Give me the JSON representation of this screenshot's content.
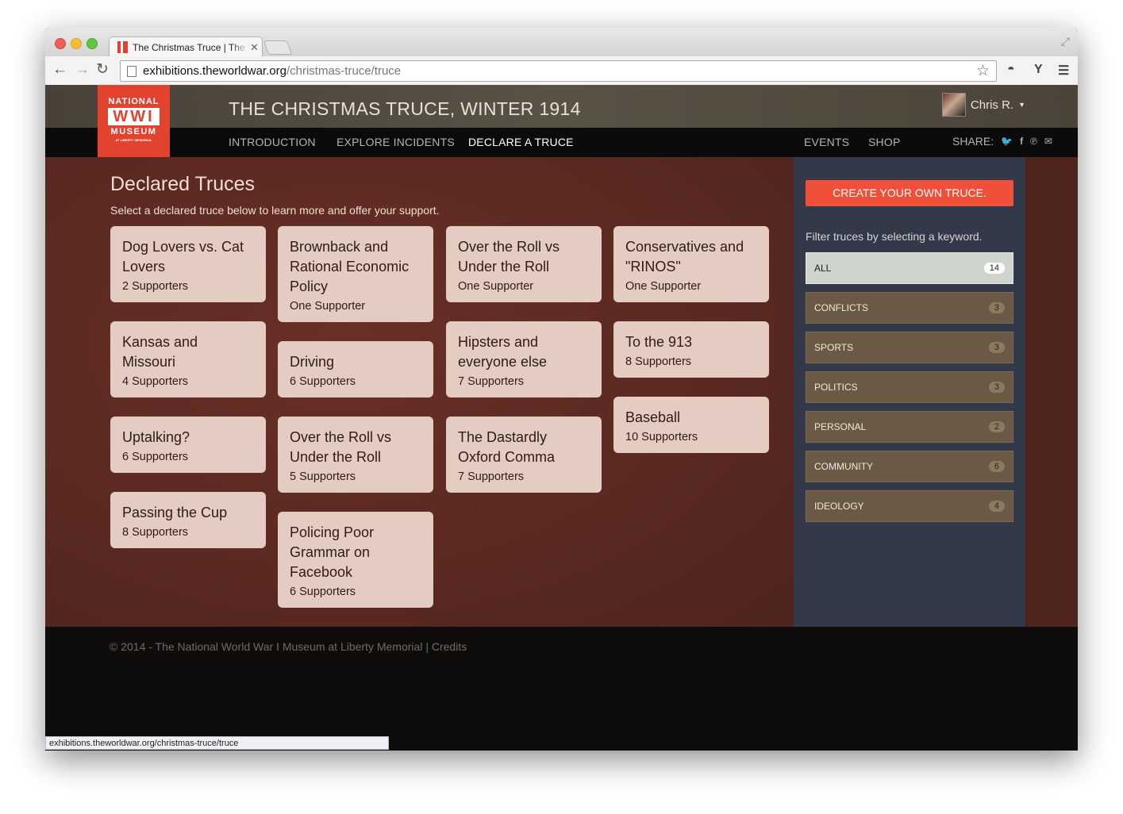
{
  "browser": {
    "tab_title": "The Christmas Truce | The",
    "url_host": "exhibitions.theworldwar.org",
    "url_path": "/christmas-truce/truce",
    "status_url": "exhibitions.theworldwar.org/christmas-truce/truce"
  },
  "site": {
    "logo": {
      "line1": "NATIONAL",
      "line2": "WWI",
      "line3": "MUSEUM",
      "line4": "AT LIBERTY MEMORIAL"
    },
    "title": "THE CHRISTMAS TRUCE, WINTER 1914",
    "user_name": "Chris R.",
    "nav": {
      "introduction": "INTRODUCTION",
      "explore": "EXPLORE INCIDENTS",
      "declare": "DECLARE A TRUCE",
      "events": "EVENTS",
      "shop": "SHOP",
      "share": "SHARE:"
    },
    "share_icons": [
      "twitter-icon",
      "facebook-icon",
      "pinterest-icon",
      "email-icon"
    ]
  },
  "main": {
    "title": "Declared Truces",
    "subtitle": "Select a declared truce below to learn more and offer your support.",
    "cards": [
      {
        "title": "Dog Lovers vs. Cat Lovers",
        "supporters": "2 Supporters"
      },
      {
        "title": "Kansas and Missouri",
        "supporters": "4 Supporters"
      },
      {
        "title": "Uptalking?",
        "supporters": "6 Supporters"
      },
      {
        "title": "Passing the Cup",
        "supporters": "8 Supporters"
      },
      {
        "title": "Brownback and Rational Economic Policy",
        "supporters": "One Supporter"
      },
      {
        "title": "Driving",
        "supporters": "6 Supporters"
      },
      {
        "title": "Over the Roll vs Under the Roll",
        "supporters": "5 Supporters"
      },
      {
        "title": "Policing Poor Grammar on Facebook",
        "supporters": "6 Supporters"
      },
      {
        "title": "Over the Roll vs Under the Roll",
        "supporters": "One Supporter"
      },
      {
        "title": "Hipsters and everyone else",
        "supporters": "7 Supporters"
      },
      {
        "title": "The Dastardly Oxford Comma",
        "supporters": "7 Supporters"
      },
      {
        "title": "Conservatives and \"RINOS\"",
        "supporters": "One Supporter"
      },
      {
        "title": "To the 913",
        "supporters": "8 Supporters"
      },
      {
        "title": "Baseball",
        "supporters": "10 Supporters"
      }
    ]
  },
  "sidebar": {
    "create_button": "CREATE YOUR OWN TRUCE.",
    "filter_label": "Filter truces by selecting a keyword.",
    "filters": [
      {
        "label": "ALL",
        "count": "14"
      },
      {
        "label": "CONFLICTS",
        "count": "3"
      },
      {
        "label": "SPORTS",
        "count": "3"
      },
      {
        "label": "POLITICS",
        "count": "3"
      },
      {
        "label": "PERSONAL",
        "count": "2"
      },
      {
        "label": "COMMUNITY",
        "count": "6"
      },
      {
        "label": "IDEOLOGY",
        "count": "4"
      }
    ]
  },
  "footer": {
    "copyright": "© 2014 - The National World War I Museum at Liberty Memorial",
    "separator": "|",
    "credits": "Credits"
  },
  "colors": {
    "accent": "#f0503a",
    "logo_red": "#e2432f",
    "card_bg": "#e5ccc3",
    "main_bg": "#5a2822",
    "sidebar_bg": "#34394a",
    "filter_bg": "#6a5a45",
    "filter_active_bg": "#cfd5cc"
  }
}
